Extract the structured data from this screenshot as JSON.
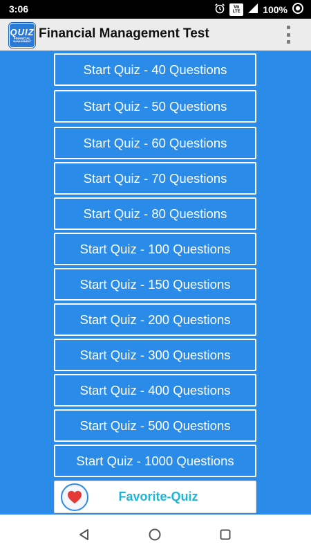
{
  "status_bar": {
    "time": "3:06",
    "network_badge_top": "Vo",
    "network_badge_bottom": "LTE",
    "battery": "100%",
    "icons": [
      "alarm-icon",
      "volte-icon",
      "signal-icon",
      "battery-icon",
      "data-saver-icon"
    ]
  },
  "app_bar": {
    "logo_main": "QUIZ",
    "logo_sub": "FINANCIAL",
    "logo_sub2": "MANAGEMENT",
    "title": "Financial Management Test",
    "menu_icon": "overflow-menu-icon"
  },
  "quiz_buttons": [
    "Start Quiz - 40 Questions",
    "Start Quiz - 50 Questions",
    "Start Quiz - 60 Questions",
    "Start Quiz - 70 Questions",
    "Start Quiz - 80 Questions",
    "Start Quiz - 100 Questions",
    "Start Quiz - 150 Questions",
    "Start Quiz - 200 Questions",
    "Start Quiz - 300 Questions",
    "Start Quiz - 400 Questions",
    "Start Quiz - 500 Questions",
    "Start Quiz - 1000 Questions"
  ],
  "favorite": {
    "label": "Favorite-Quiz",
    "icon": "heart-icon"
  },
  "nav_bar": {
    "icons": [
      "back-icon",
      "home-icon",
      "recents-icon"
    ]
  },
  "colors": {
    "content_background": "#2a8be8",
    "button_border": "#ffffff",
    "favorite_text": "#1cb6d6",
    "heart": "#e53935",
    "app_bar": "#ececec"
  }
}
